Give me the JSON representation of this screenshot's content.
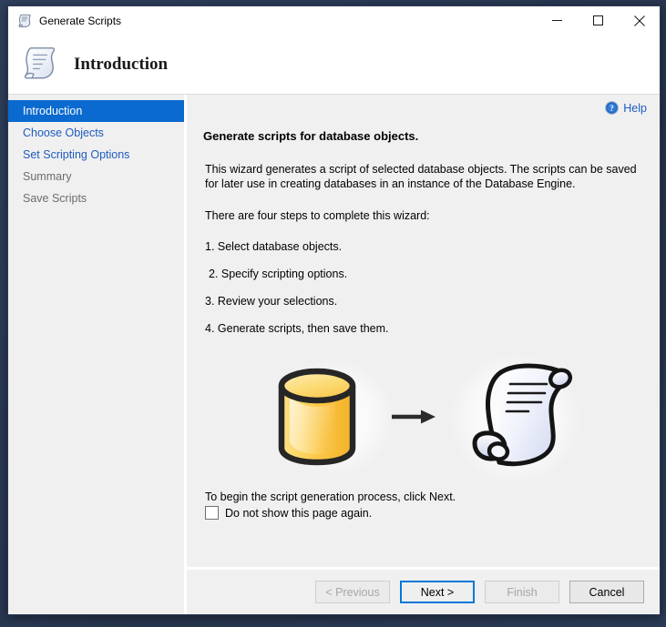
{
  "window": {
    "title": "Generate Scripts",
    "title_icon": "script-scroll-icon",
    "minimize_label": "Minimize",
    "maximize_label": "Maximize",
    "close_label": "Close"
  },
  "header": {
    "icon": "script-scroll-icon",
    "title": "Introduction"
  },
  "sidebar": {
    "items": [
      {
        "label": "Introduction",
        "state": "active"
      },
      {
        "label": "Choose Objects",
        "state": "link"
      },
      {
        "label": "Set Scripting Options",
        "state": "link"
      },
      {
        "label": "Summary",
        "state": "disabled"
      },
      {
        "label": "Save Scripts",
        "state": "disabled"
      }
    ]
  },
  "help": {
    "label": "Help",
    "icon": "help-circle-icon"
  },
  "content": {
    "lead": "Generate scripts for database objects.",
    "paragraph": "This wizard generates a script of selected database objects. The scripts can be saved for later use in creating databases in an instance of the Database Engine.",
    "steps_intro": "There are four steps to complete this wizard:",
    "steps": [
      "1. Select database objects.",
      "2. Specify scripting options.",
      "3. Review your selections.",
      "4. Generate scripts, then save them."
    ],
    "graphic": {
      "source_icon": "database-cylinder-icon",
      "arrow_icon": "arrow-right-icon",
      "target_icon": "script-scroll-icon"
    },
    "begin_text": "To begin the script generation process, click Next.",
    "dont_show_label": "Do not show this page again.",
    "dont_show_checked": false
  },
  "buttons": [
    {
      "label": "< Previous",
      "state": "disabled"
    },
    {
      "label": "Next >",
      "state": "default"
    },
    {
      "label": "Finish",
      "state": "disabled"
    },
    {
      "label": "Cancel",
      "state": "normal"
    }
  ],
  "colors": {
    "accent": "#0b6ad0",
    "link": "#1f5bbf",
    "focus": "#0078d7",
    "desktop": "#2b3a55",
    "panel": "#f0f0f0"
  }
}
